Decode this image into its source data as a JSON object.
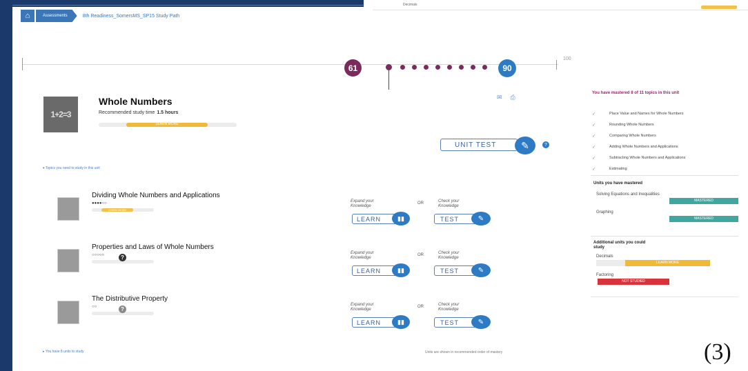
{
  "breadcrumb": {
    "home_icon": "home-icon",
    "assessments": "Assessments",
    "path": "8th Readiness_SomersMS_SP15 Study Path"
  },
  "topbar_right": {
    "text": "Decimals"
  },
  "progress": {
    "max_label": "100",
    "start_score": "61",
    "target_score": "90"
  },
  "unit": {
    "icon_glyph": "1+2=3",
    "title": "Whole Numbers",
    "study_label": "Recommended study time",
    "study_value": "1.5 hours",
    "status": "LEARN MORE"
  },
  "unit_test": {
    "label": "UNIT TEST",
    "help": "?"
  },
  "topics_note": "Topics you need to study in this unit",
  "topics": [
    {
      "name": "Dividing Whole Numbers and Applications",
      "status": "LEARN MORE",
      "expand": "Expand your Knowledge",
      "or": "OR",
      "check": "Check your Knowledge",
      "learn": "LEARN",
      "test": "TEST"
    },
    {
      "name": "Properties and Laws of Whole Numbers",
      "expand": "Expand your Knowledge",
      "or": "OR",
      "check": "Check your Knowledge",
      "learn": "LEARN",
      "test": "TEST",
      "help": "?"
    },
    {
      "name": "The Distributive Property",
      "expand": "Expand your Knowledge",
      "or": "OR",
      "check": "Check your Knowledge",
      "learn": "LEARN",
      "test": "TEST",
      "help": "?"
    }
  ],
  "more_link": "You have 8 units to study",
  "footer_note": "Units are shown in recommended order of mastery",
  "right_panel": {
    "heading": "You have mastered 8 of 11 topics in this unit",
    "mastered_topics": [
      "Place Value and Names for Whole Numbers",
      "Rounding Whole Numbers",
      "Comparing Whole Numbers",
      "Adding Whole Numbers and Applications",
      "Subtracting Whole Numbers and Applications",
      "Estimating"
    ],
    "units_mastered_heading": "Units you have mastered",
    "units_mastered": [
      {
        "name": "Solving Equations and Inequalities",
        "status": "MASTERED"
      },
      {
        "name": "Graphing",
        "status": "MASTERED"
      }
    ],
    "additional_heading": "Additional units you could study",
    "additional_units": [
      {
        "name": "Decimals",
        "status": "LEARN MORE",
        "color": "#f0b93a"
      },
      {
        "name": "Factoring",
        "status": "NOT STUDIED",
        "color": "#d8323a"
      }
    ]
  },
  "figure_number": "(3)",
  "colors": {
    "navy": "#1b3a6b",
    "blue": "#2d7bc4",
    "purple": "#7a2a5c",
    "teal": "#3fa6a1",
    "amber": "#f0b93a",
    "red": "#d8323a"
  }
}
